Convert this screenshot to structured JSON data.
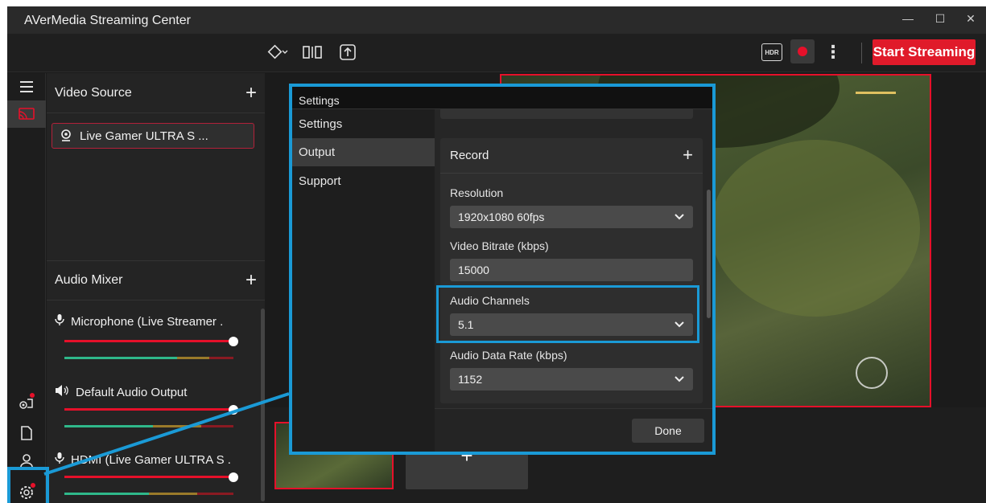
{
  "window": {
    "title": "AVerMedia Streaming Center",
    "controls": [
      "—",
      "☐",
      "✕"
    ]
  },
  "toolbar": {
    "hdr_label": "HDR",
    "more_label": "⋮",
    "start_label": "Start Streaming",
    "accent": "#e01a2a"
  },
  "sidebar_rail": {
    "icons": [
      "menu-icon",
      "broadcast-icon",
      "camera-settings-icon",
      "document-icon",
      "profile-icon",
      "gear-icon"
    ]
  },
  "video_source": {
    "title": "Video Source",
    "items": [
      {
        "label": "Live Gamer ULTRA S ..."
      }
    ]
  },
  "audio_mixer": {
    "title": "Audio Mixer",
    "channels": [
      {
        "label": "Microphone (Live Streamer .",
        "level": 0.95
      },
      {
        "label": "Default Audio Output",
        "level": 0.95
      },
      {
        "label": "HDMI (Live Gamer ULTRA S .",
        "level": 0.95
      }
    ]
  },
  "settings_dialog": {
    "title": "Settings",
    "nav": [
      "Settings",
      "Output",
      "Support"
    ],
    "active_nav": "Output",
    "record_section": "Record",
    "fields": {
      "resolution_label": "Resolution",
      "resolution_value": "1920x1080 60fps",
      "bitrate_label": "Video Bitrate (kbps)",
      "bitrate_value": "15000",
      "channels_label": "Audio Channels",
      "channels_value": "5.1",
      "datarate_label": "Audio Data Rate (kbps)",
      "datarate_value": "1152"
    },
    "done_label": "Done",
    "highlight_color": "#1a9ad6"
  }
}
